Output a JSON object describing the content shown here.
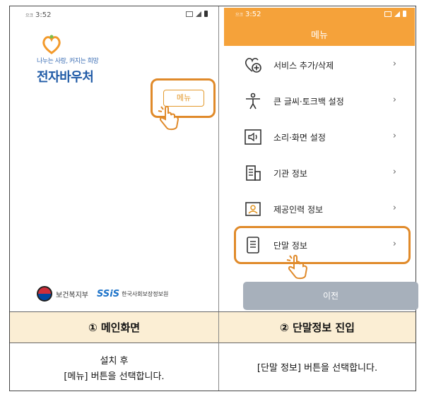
{
  "left_screen": {
    "status_time": "3:52",
    "status_prefix": "으크",
    "tagline": "나누는 사랑, 커지는 희망",
    "brand": "전자바우처",
    "menu_button": "메뉴",
    "org1": "보건복지부",
    "org2_logo": "SSiS",
    "org2": "한국사회보장정보원"
  },
  "right_screen": {
    "status_time": "3:52",
    "status_prefix": "으크",
    "title": "메뉴",
    "items": [
      {
        "label": "서비스 추가/삭제",
        "icon": "heart-plus-icon"
      },
      {
        "label": "큰 글씨·토크백 설정",
        "icon": "accessibility-icon"
      },
      {
        "label": "소리·화면 설정",
        "icon": "speaker-icon"
      },
      {
        "label": "기관 정보",
        "icon": "building-icon"
      },
      {
        "label": "제공인력 정보",
        "icon": "person-card-icon"
      },
      {
        "label": "단말 정보",
        "icon": "device-icon"
      }
    ],
    "chevron": "›",
    "prev_button": "이전"
  },
  "captions": {
    "step1": "① 메인화면",
    "step2": "② 단말정보 진입",
    "desc1_line1": "설치 후",
    "desc1_line2": "[메뉴] 버튼을 선택합니다.",
    "desc2": "[단말 정보] 버튼을 선택합니다."
  },
  "colors": {
    "accent_orange": "#f5a23a",
    "highlight": "#e08a2a",
    "brand_blue": "#1f5aa6",
    "caption_band": "#fbeed4",
    "disabled_button": "#a7b0bb"
  }
}
